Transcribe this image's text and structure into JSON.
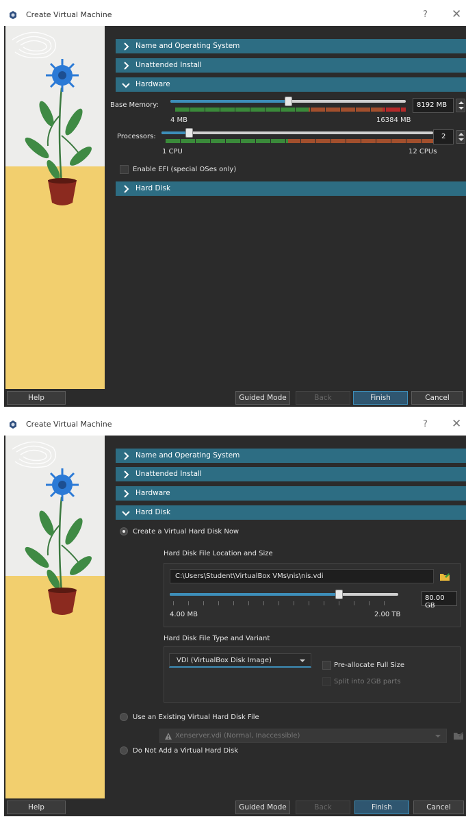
{
  "window_title": "Create Virtual Machine",
  "help_glyph": "?",
  "close_glyph": "✕",
  "colors": {
    "accent": "#2d6d83",
    "slider_fill": "#3d8eb9",
    "zone_green": "#3a8a3a",
    "zone_orange": "#a24f2d",
    "zone_red": "#b52a2a"
  },
  "sections": {
    "name_os": "Name and Operating System",
    "unattended": "Unattended Install",
    "hardware": "Hardware",
    "hard_disk": "Hard Disk"
  },
  "hardware": {
    "base_memory_label": "Base Memory:",
    "memory_value": "8192 MB",
    "memory_min": "4 MB",
    "memory_max": "16384 MB",
    "memory_fraction": 0.5,
    "processors_label": "Processors:",
    "processors_value": "2",
    "proc_min": "1 CPU",
    "proc_max": "12 CPUs",
    "proc_fraction": 0.09,
    "efi_label": "Enable EFI (special OSes only)"
  },
  "hard_disk": {
    "create_now": "Create a Virtual Hard Disk Now",
    "location_size_title": "Hard Disk File Location and Size",
    "path": "C:\\Users\\Student\\VirtualBox VMs\\nis\\nis.vdi",
    "size_value": "80.00 GB",
    "size_min": "4.00 MB",
    "size_max": "2.00 TB",
    "size_fraction": 0.75,
    "type_variant_title": "Hard Disk File Type and Variant",
    "type_value": "VDI (VirtualBox Disk Image)",
    "preallocate": "Pre-allocate Full Size",
    "split": "Split into 2GB parts",
    "use_existing": "Use an Existing Virtual Hard Disk File",
    "existing_value": "Xenserver.vdi (Normal, Inaccessible)",
    "no_disk": "Do Not Add a Virtual Hard Disk"
  },
  "footer": {
    "help": "Help",
    "guided": "Guided Mode",
    "back": "Back",
    "finish": "Finish",
    "cancel": "Cancel"
  }
}
